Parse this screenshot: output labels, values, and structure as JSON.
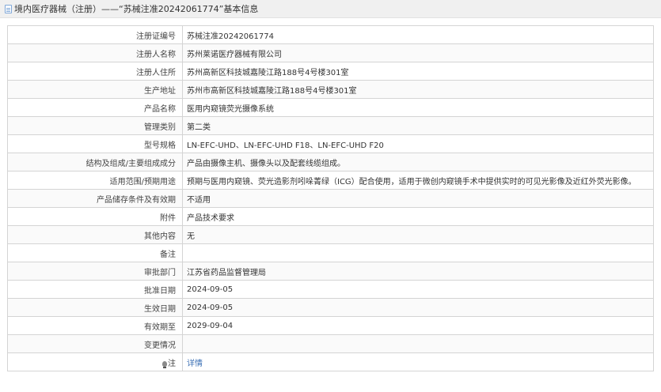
{
  "header": {
    "title": "境内医疗器械（注册）——“苏械注准20242061774”基本信息"
  },
  "rows": [
    {
      "label": "注册证编号",
      "value": "苏械注准20242061774"
    },
    {
      "label": "注册人名称",
      "value": "苏州莱诺医疗器械有限公司"
    },
    {
      "label": "注册人住所",
      "value": "苏州高新区科技城嘉陵江路188号4号楼301室"
    },
    {
      "label": "生产地址",
      "value": "苏州市高新区科技城嘉陵江路188号4号楼301室"
    },
    {
      "label": "产品名称",
      "value": "医用内窥镜荧光摄像系统"
    },
    {
      "label": "管理类别",
      "value": "第二类"
    },
    {
      "label": "型号规格",
      "value": "LN-EFC-UHD、LN-EFC-UHD F18、LN-EFC-UHD F20"
    },
    {
      "label": "结构及组成/主要组成成分",
      "value": "产品由摄像主机、摄像头以及配套线缆组成。"
    },
    {
      "label": "适用范围/预期用途",
      "value": "预期与医用内窥镜、荧光造影剂吲哚菁绿（ICG）配合使用，适用于微创内窥镜手术中提供实时的可见光影像及近红外荧光影像。"
    },
    {
      "label": "产品储存条件及有效期",
      "value": "不适用"
    },
    {
      "label": "附件",
      "value": "产品技术要求"
    },
    {
      "label": "其他内容",
      "value": "无"
    },
    {
      "label": "备注",
      "value": ""
    },
    {
      "label": "审批部门",
      "value": "江苏省药品监督管理局"
    },
    {
      "label": "批准日期",
      "value": "2024-09-05"
    },
    {
      "label": "生效日期",
      "value": "2024-09-05"
    },
    {
      "label": "有效期至",
      "value": "2029-09-04"
    },
    {
      "label": "变更情况",
      "value": ""
    }
  ],
  "note": {
    "label": "注",
    "link_text": "详情"
  }
}
